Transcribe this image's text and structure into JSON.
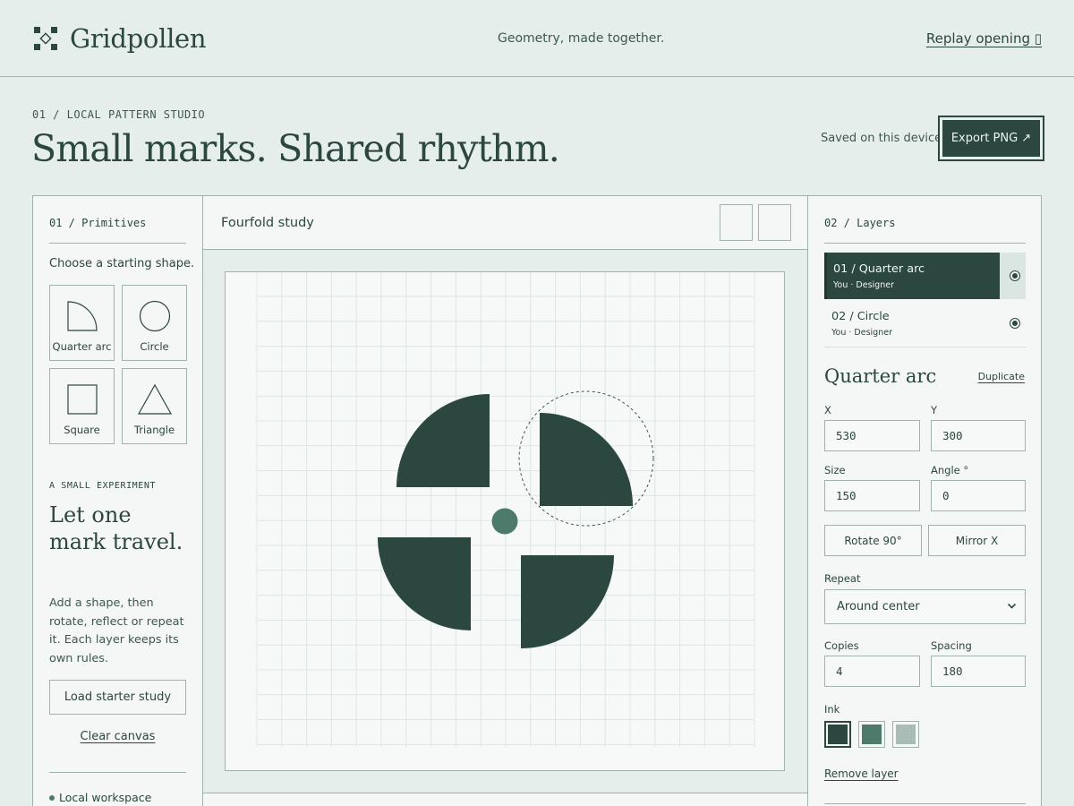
{
  "header": {
    "brand": "Gridpollen",
    "tagline": "Geometry, made together.",
    "replay_label": "Replay opening ▯"
  },
  "hero": {
    "eyebrow": "01 / LOCAL PATTERN STUDIO",
    "headline": "Small marks. Shared rhythm.",
    "saved_status": "Saved on this device",
    "export_label": "Export PNG ↗"
  },
  "primitives": {
    "label": "01 / Primitives",
    "hint": "Choose a starting shape.",
    "shapes": [
      {
        "label": "Quarter arc",
        "icon": "quarter-arc-icon"
      },
      {
        "label": "Circle",
        "icon": "circle-icon"
      },
      {
        "label": "Square",
        "icon": "square-icon"
      },
      {
        "label": "Triangle",
        "icon": "triangle-icon"
      }
    ],
    "experiment_eyebrow": "A SMALL EXPERIMENT",
    "experiment_title": "Let one mark travel.",
    "experiment_body": "Add a shape, then rotate, reflect or repeat it. Each layer keeps its own rules.",
    "starter_label": "Load starter study",
    "clear_label": "Clear canvas",
    "workspace_label": "Local workspace"
  },
  "canvas": {
    "title": "Fourfold study"
  },
  "layers": {
    "label": "02 / Layers",
    "items": [
      {
        "name": "01 / Quarter arc",
        "owner": "You · Designer",
        "active": true
      },
      {
        "name": "02 / Circle",
        "owner": "You · Designer",
        "active": false
      }
    ]
  },
  "inspector": {
    "shape_name": "Quarter arc",
    "duplicate_label": "Duplicate",
    "x_label": "X",
    "x_value": "530",
    "y_label": "Y",
    "y_value": "300",
    "size_label": "Size",
    "size_value": "150",
    "angle_label": "Angle °",
    "angle_value": "0",
    "rotate_label": "Rotate 90°",
    "mirror_label": "Mirror X",
    "repeat_label": "Repeat",
    "repeat_value": "Around center",
    "copies_label": "Copies",
    "copies_value": "4",
    "spacing_label": "Spacing",
    "spacing_value": "180",
    "ink_label": "Ink",
    "inks": [
      "#2c4640",
      "#4e7a6c",
      "#a9bdb6"
    ],
    "selected_ink": 0,
    "remove_label": "Remove layer"
  },
  "colors": {
    "background": "#e6eeeb",
    "ink": "#2c4640",
    "accent_dot": "#4e7a6c",
    "rule": "#9fb3ac"
  }
}
